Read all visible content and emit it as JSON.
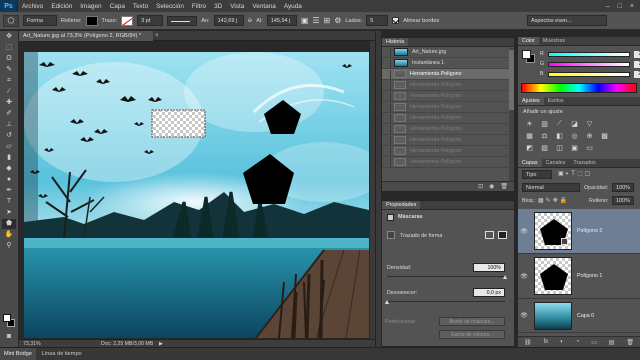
{
  "menubar": {
    "logo": "Ps",
    "items": [
      "Archivo",
      "Edición",
      "Imagen",
      "Capa",
      "Texto",
      "Selección",
      "Filtro",
      "3D",
      "Vista",
      "Ventana",
      "Ayuda"
    ],
    "window_controls": [
      "–",
      "□",
      "×"
    ]
  },
  "options_bar": {
    "shape_mode": "Forma",
    "fill_label": "Relleno:",
    "stroke_label": "Trazo:",
    "stroke_width": "3 pt",
    "width_label": "An:",
    "width_value": "142,69 j",
    "link_symbol": "⊖",
    "height_label": "Al:",
    "height_value": "145,94 j",
    "sides_label": "Lados:",
    "sides_value": "5",
    "align_edges_label": "Alinear bordes",
    "workspace": "Aspectos esen..."
  },
  "document": {
    "tab_title": "Art_Nature.jpg al 73,3% (Polígono 2, RGB/8#) *",
    "zoom": "73,31%",
    "doc_size": "Doc: 2,25 MB/3,00 MB"
  },
  "bottom_tabs": [
    "Mini Bridge",
    "Línea de tiempo"
  ],
  "history": {
    "tabs": [
      "Historia"
    ],
    "items": [
      {
        "label": "Art_Nature.jpg",
        "kind": "snapshot",
        "state": "normal"
      },
      {
        "label": "Instantánea 1",
        "kind": "snapshot",
        "state": "normal"
      },
      {
        "label": "Herramienta Polígono",
        "kind": "step",
        "state": "active"
      },
      {
        "label": "Herramienta Polígono",
        "kind": "step",
        "state": "dim"
      },
      {
        "label": "Herramienta Polígono",
        "kind": "step",
        "state": "dim"
      },
      {
        "label": "Herramienta Polígono",
        "kind": "step",
        "state": "dim"
      },
      {
        "label": "Herramienta Polígono",
        "kind": "step",
        "state": "dim"
      },
      {
        "label": "Herramienta Polígono",
        "kind": "step",
        "state": "dim"
      },
      {
        "label": "Herramienta Polígono",
        "kind": "step",
        "state": "dim"
      },
      {
        "label": "Herramienta Polígono",
        "kind": "step",
        "state": "dim"
      },
      {
        "label": "Herramienta Polígono",
        "kind": "step",
        "state": "dim"
      }
    ]
  },
  "properties": {
    "tab": "Propiedades",
    "section": "Máscaras",
    "vector_mask": "Trazado de forma",
    "density_label": "Densidad:",
    "density_value": "100%",
    "feather_label": "Desvanecer:",
    "feather_value": "0,0 px",
    "refine_label": "Perfeccionar:",
    "mask_edge_button": "Borde de máscara...",
    "color_range_button": "Gama de colores...",
    "density_fraction": 1.0,
    "feather_fraction": 0.0
  },
  "color_panel": {
    "tabs": [
      "Color",
      "Muestras"
    ],
    "rows": [
      {
        "channel": "R",
        "value": "255"
      },
      {
        "channel": "G",
        "value": "255"
      },
      {
        "channel": "B",
        "value": "255"
      }
    ]
  },
  "adjustments": {
    "tabs": [
      "Ajustes",
      "Estilos"
    ],
    "heading": "Añadir un ajuste"
  },
  "layers": {
    "tabs": [
      "Capas",
      "Canales",
      "Trazados"
    ],
    "filter_kind": "Tipo",
    "blend_mode": "Normal",
    "opacity_label": "Opacidad:",
    "opacity_value": "100%",
    "lock_label": "Bloq.:",
    "fill_label": "Relleno:",
    "fill_value": "100%",
    "items": [
      {
        "name": "Polígono 2",
        "selected": true
      },
      {
        "name": "Polígono 1",
        "selected": false
      },
      {
        "name": "Capa 0",
        "selected": false
      }
    ],
    "footer_icons": [
      "⛓",
      "fx",
      "◐",
      "◔",
      "▭",
      "▤",
      "🗑"
    ]
  },
  "colors": {
    "accent_selection": "#6a6a6a",
    "layer_selected": "#6d7e95",
    "panel_bg": "#535353"
  }
}
